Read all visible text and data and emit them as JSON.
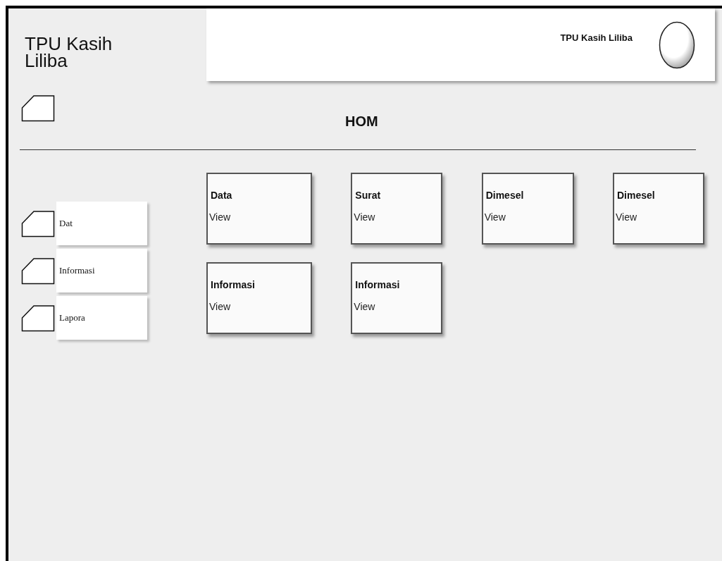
{
  "app_title": "TPU Kasih Liliba",
  "header": {
    "title": "TPU Kasih Liliba"
  },
  "page_heading": "HOM",
  "sidebar": {
    "items": [
      {
        "label": "Dat"
      },
      {
        "label": "Informasi"
      },
      {
        "label": "Lapora"
      }
    ]
  },
  "cards": [
    {
      "title": "Data",
      "action": "View"
    },
    {
      "title": "Surat",
      "action": "View"
    },
    {
      "title": "Dimesel",
      "action": "View"
    },
    {
      "title": "Dimesel",
      "action": "View"
    },
    {
      "title": "Informasi",
      "action": "View"
    },
    {
      "title": "Informasi",
      "action": "View"
    }
  ]
}
